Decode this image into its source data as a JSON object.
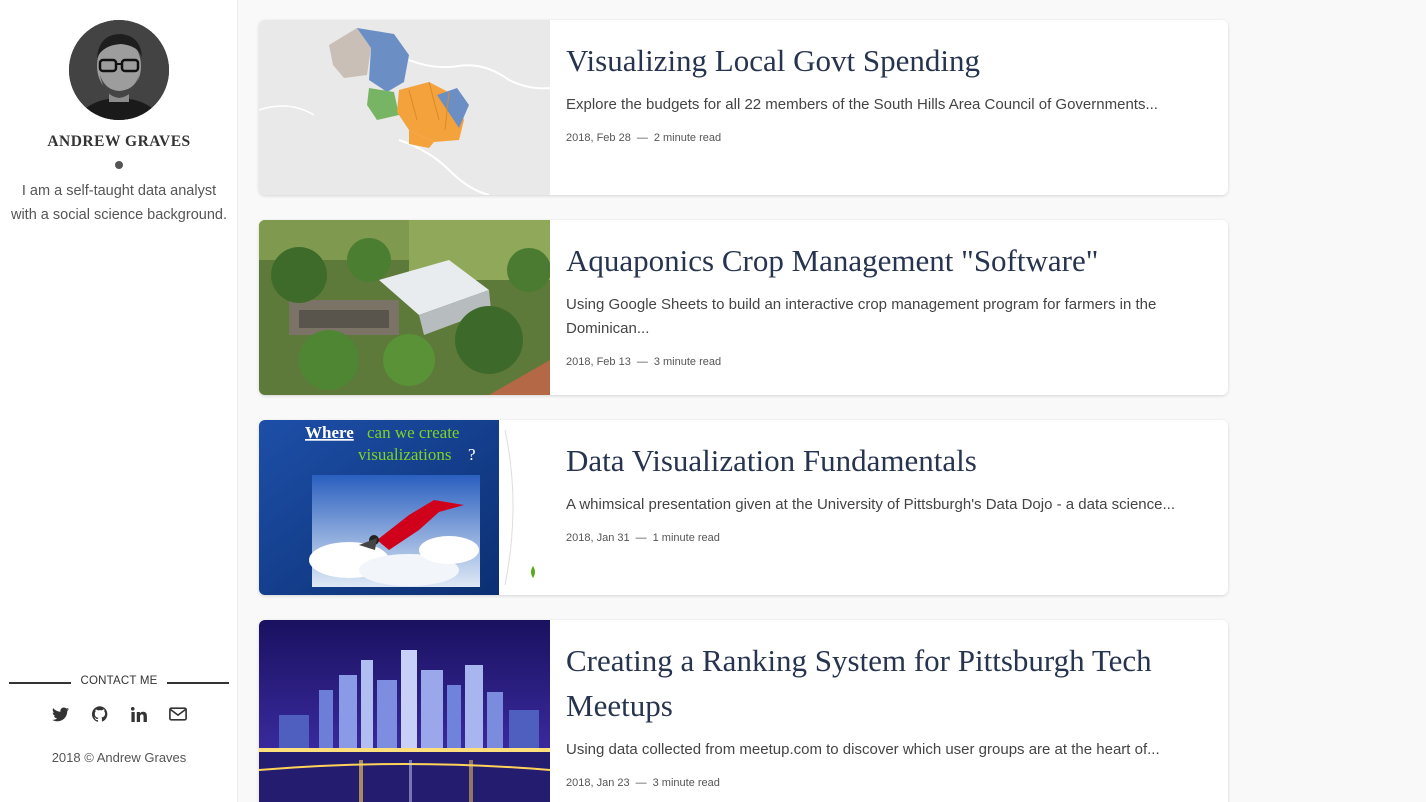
{
  "sidebar": {
    "author_name": "ANDREW GRAVES",
    "bio": "I am a self-taught data analyst with a social science background.",
    "contact_heading": "CONTACT ME",
    "social_icons": [
      "twitter-icon",
      "github-icon",
      "linkedin-icon",
      "email-icon"
    ],
    "footer": "2018 © Andrew Graves"
  },
  "posts": [
    {
      "title": "Visualizing Local Govt Spending",
      "excerpt": "Explore the budgets for all 22 members of the South Hills Area Council of Governments...",
      "date": "2018, Feb 28",
      "separator": "—",
      "read_time": "2 minute read",
      "thumbnail": "map-thumbnail"
    },
    {
      "title": "Aquaponics Crop Management \"Software\"",
      "excerpt": "Using Google Sheets to build an interactive crop management program for farmers in the Dominican...",
      "date": "2018, Feb 13",
      "separator": "—",
      "read_time": "3 minute read",
      "thumbnail": "farm-aerial-thumbnail"
    },
    {
      "title": "Data Visualization Fundamentals",
      "excerpt": "A whimsical presentation given at the University of Pittsburgh's Data Dojo - a data science...",
      "date": "2018, Jan 31",
      "separator": "—",
      "read_time": "1 minute read",
      "thumbnail": "slide-thumbnail",
      "slide_text_where": "Where",
      "slide_text_rest": "can we create",
      "slide_text_line2": "visualizations",
      "slide_text_q": "?"
    },
    {
      "title": "Creating a Ranking System for Pittsburgh Tech Meetups",
      "excerpt": "Using data collected from meetup.com to discover which user groups are at the heart of...",
      "date": "2018, Jan 23",
      "separator": "—",
      "read_time": "3 minute read",
      "thumbnail": "city-skyline-thumbnail"
    }
  ],
  "colors": {
    "title": "#27344f",
    "page_bg": "#f9f9f9",
    "sidebar_bg": "#ffffff"
  }
}
